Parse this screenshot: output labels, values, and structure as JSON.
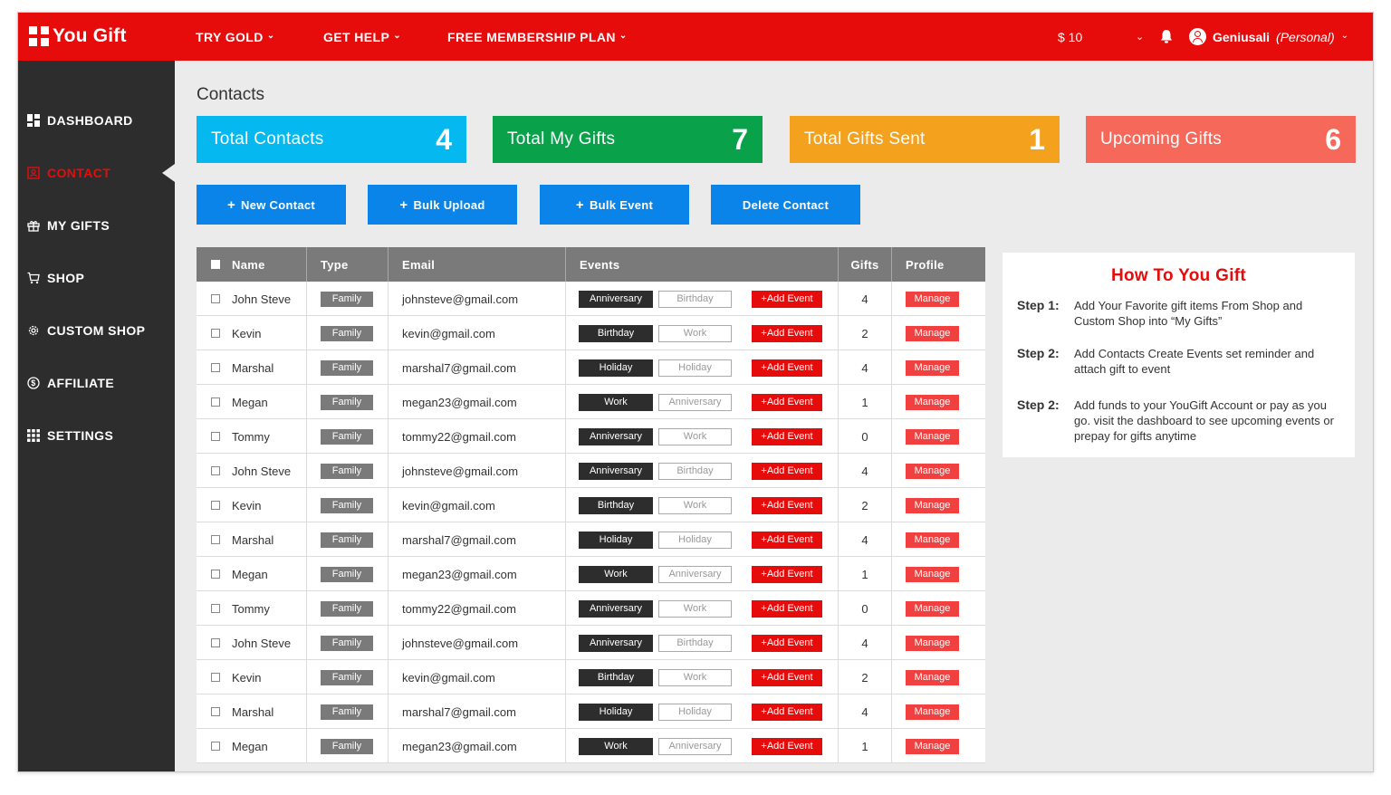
{
  "header": {
    "logo": "You Gift",
    "nav": [
      "TRY GOLD",
      "GET HELP",
      "FREE MEMBERSHIP PLAN"
    ],
    "balance": "$ 10",
    "user_name": "Geniusali",
    "user_plan": "(Personal)"
  },
  "sidebar": {
    "items": [
      {
        "label": "DASHBOARD",
        "icon": "dashboard-icon"
      },
      {
        "label": "CONTACT",
        "icon": "contact-icon",
        "active": true
      },
      {
        "label": "MY GIFTS",
        "icon": "gift-icon"
      },
      {
        "label": "SHOP",
        "icon": "cart-icon"
      },
      {
        "label": "CUSTOM SHOP",
        "icon": "gear-icon"
      },
      {
        "label": "AFFILIATE",
        "icon": "dollar-icon"
      },
      {
        "label": "SETTINGS",
        "icon": "grid-icon"
      }
    ]
  },
  "page": {
    "title": "Contacts"
  },
  "stats": [
    {
      "label": "Total Contacts",
      "value": "4",
      "color": "#05b9f0"
    },
    {
      "label": "Total My Gifts",
      "value": "7",
      "color": "#0aa14b"
    },
    {
      "label": "Total Gifts Sent",
      "value": "1",
      "color": "#f4a11e"
    },
    {
      "label": "Upcoming Gifts",
      "value": "6",
      "color": "#f6685a"
    }
  ],
  "actions": [
    {
      "label": "New Contact",
      "plus": "+"
    },
    {
      "label": "Bulk Upload",
      "plus": "+"
    },
    {
      "label": "Bulk Event",
      "plus": "+"
    },
    {
      "label": "Delete Contact",
      "plus": ""
    }
  ],
  "table": {
    "headers": {
      "name": "Name",
      "type": "Type",
      "email": "Email",
      "events": "Events",
      "gifts": "Gifts",
      "profile": "Profile"
    },
    "add_event_label": "+Add Event",
    "manage_label": "Manage",
    "rows": [
      {
        "name": "John Steve",
        "type": "Family",
        "email": "johnsteve@gmail.com",
        "event1": "Anniversary",
        "event2": "Birthday",
        "gifts": "4"
      },
      {
        "name": "Kevin",
        "type": "Family",
        "email": "kevin@gmail.com",
        "event1": "Birthday",
        "event2": "Work",
        "gifts": "2"
      },
      {
        "name": "Marshal",
        "type": "Family",
        "email": "marshal7@gmail.com",
        "event1": "Holiday",
        "event2": "Holiday",
        "gifts": "4"
      },
      {
        "name": "Megan",
        "type": "Family",
        "email": "megan23@gmail.com",
        "event1": "Work",
        "event2": "Anniversary",
        "gifts": "1"
      },
      {
        "name": "Tommy",
        "type": "Family",
        "email": "tommy22@gmail.com",
        "event1": "Anniversary",
        "event2": "Work",
        "gifts": "0"
      },
      {
        "name": "John Steve",
        "type": "Family",
        "email": "johnsteve@gmail.com",
        "event1": "Anniversary",
        "event2": "Birthday",
        "gifts": "4"
      },
      {
        "name": "Kevin",
        "type": "Family",
        "email": "kevin@gmail.com",
        "event1": "Birthday",
        "event2": "Work",
        "gifts": "2"
      },
      {
        "name": "Marshal",
        "type": "Family",
        "email": "marshal7@gmail.com",
        "event1": "Holiday",
        "event2": "Holiday",
        "gifts": "4"
      },
      {
        "name": "Megan",
        "type": "Family",
        "email": "megan23@gmail.com",
        "event1": "Work",
        "event2": "Anniversary",
        "gifts": "1"
      },
      {
        "name": "Tommy",
        "type": "Family",
        "email": "tommy22@gmail.com",
        "event1": "Anniversary",
        "event2": "Work",
        "gifts": "0"
      },
      {
        "name": "John Steve",
        "type": "Family",
        "email": "johnsteve@gmail.com",
        "event1": "Anniversary",
        "event2": "Birthday",
        "gifts": "4"
      },
      {
        "name": "Kevin",
        "type": "Family",
        "email": "kevin@gmail.com",
        "event1": "Birthday",
        "event2": "Work",
        "gifts": "2"
      },
      {
        "name": "Marshal",
        "type": "Family",
        "email": "marshal7@gmail.com",
        "event1": "Holiday",
        "event2": "Holiday",
        "gifts": "4"
      },
      {
        "name": "Megan",
        "type": "Family",
        "email": "megan23@gmail.com",
        "event1": "Work",
        "event2": "Anniversary",
        "gifts": "1"
      }
    ]
  },
  "info": {
    "title": "How To You Gift",
    "steps": [
      {
        "key": "Step 1:",
        "text": "Add Your Favorite gift items From Shop and Custom Shop into “My Gifts”"
      },
      {
        "key": "Step 2:",
        "text": "Add Contacts Create Events set reminder and attach gift to event"
      },
      {
        "key": "Step 2:",
        "text": "Add funds to your YouGift Account or pay as you go. visit the dashboard to see upcoming events or prepay for gifts anytime"
      }
    ]
  }
}
